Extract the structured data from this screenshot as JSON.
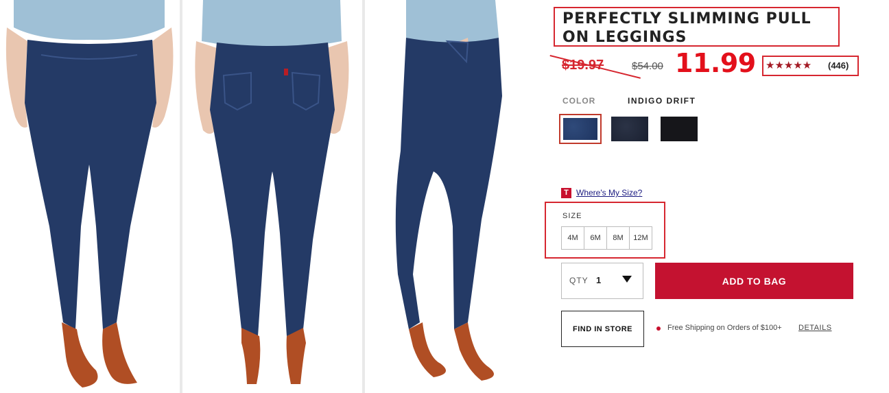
{
  "product": {
    "title": "PERFECTLY SLIMMING PULL ON LEGGINGS",
    "price_original_struck": "$19.97",
    "price_list_struck": "$54.00",
    "price_current": "11.99",
    "rating_stars": "★★★★★",
    "rating_value": 4.5,
    "review_count": "(446)"
  },
  "color": {
    "label": "COLOR",
    "selected_name": "INDIGO DRIFT",
    "swatches": [
      {
        "name": "indigo-drift",
        "hex": "#26406e",
        "selected": true
      },
      {
        "name": "dark-indigo",
        "hex": "#222a3c",
        "selected": false
      },
      {
        "name": "black",
        "hex": "#16161a",
        "selected": false
      }
    ]
  },
  "size": {
    "badge": "T",
    "help_link": "Where's My Size?",
    "label": "SIZE",
    "options": [
      "4M",
      "6M",
      "8M",
      "12M"
    ]
  },
  "qty": {
    "label": "QTY",
    "value": "1"
  },
  "actions": {
    "add_to_bag": "ADD TO BAG",
    "find_in_store": "FIND IN STORE"
  },
  "shipping": {
    "text": "Free Shipping on Orders of $100+",
    "link": "DETAILS"
  },
  "colors": {
    "accent_red": "#c41230",
    "annotation_red": "#d6262f",
    "price_red": "#e3101b",
    "denim": "#243a66"
  }
}
